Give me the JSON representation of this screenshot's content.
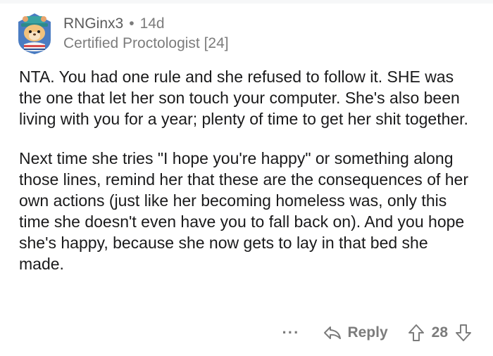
{
  "comment": {
    "author": "RNGinx3",
    "separator": "•",
    "age": "14d",
    "flair": "Certified Proctologist [24]",
    "paragraphs": [
      "NTA. You had one rule and she refused to follow it. SHE was the one that let her son touch your computer. She's also been living with you for a year; plenty of time to get her shit together.",
      "Next time she tries \"I hope you're happy\" or something along those lines, remind her that these are the consequences of her own actions (just like her becoming homeless was, only this time she doesn't even have you to fall back on). And you hope she's happy, because she now gets to lay in that bed she made."
    ]
  },
  "actions": {
    "more_label": "···",
    "reply_label": "Reply",
    "score": "28"
  },
  "colors": {
    "text": "#1a1a1b",
    "meta": "#7c7c7c",
    "avatar_bg": "#4a7cc2"
  },
  "icons": {
    "reply": "reply-arrow-icon",
    "upvote": "upvote-arrow-icon",
    "downvote": "downvote-arrow-icon",
    "avatar": "snoo-avatar"
  }
}
